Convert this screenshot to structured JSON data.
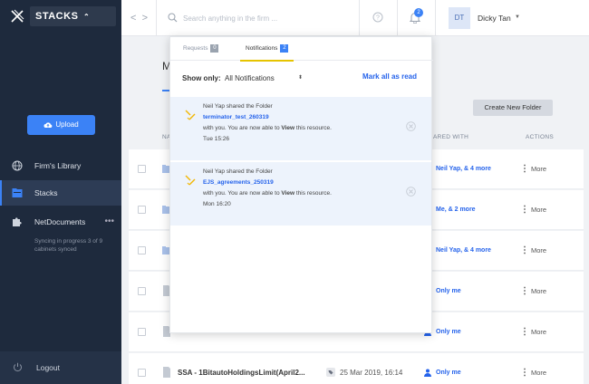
{
  "sidebar": {
    "app_name": "STACKS",
    "upload_label": "Upload",
    "items": [
      {
        "label": "Firm's Library"
      },
      {
        "label": "Stacks"
      },
      {
        "label": "NetDocuments",
        "extra": "•••"
      }
    ],
    "sync_note": "Syncing in progress 3 of 9 cabinets synced",
    "logout_label": "Logout"
  },
  "topbar": {
    "search_placeholder": "Search anything in the firm ...",
    "notification_count": "2",
    "avatar_initials": "DT",
    "user_name": "Dicky Tan"
  },
  "page": {
    "title_initial": "M",
    "create_folder_label": "Create New Folder",
    "columns": {
      "name": "NA",
      "shared_with": "ARED WITH",
      "actions": "ACTIONS"
    },
    "rows": [
      {
        "shared": "Neil Yap, & 4 more",
        "more": "More"
      },
      {
        "shared": "Me, & 2 more",
        "more": "More"
      },
      {
        "shared": "Neil Yap, & 4 more",
        "more": "More"
      },
      {
        "shared": "Only me",
        "more": "More"
      },
      {
        "shared": "Only me",
        "more": "More"
      },
      {
        "name": "SSA - 1BitautoHoldingsLimit(April2...",
        "date": "25 Mar 2019, 16:14",
        "shared": "Only me",
        "more": "More"
      }
    ]
  },
  "notifications_panel": {
    "tabs": [
      {
        "label": "Requests",
        "count": "0"
      },
      {
        "label": "Notifications",
        "count": "2"
      }
    ],
    "show_only_label": "Show only:",
    "filter_value": "All Notifications",
    "mark_all_label": "Mark all as read",
    "items": [
      {
        "line1": "Neil Yap shared the Folder",
        "folder": "terminator_test_260319",
        "line3_prefix": "with you. You are now able to ",
        "line3_bold": "View",
        "line3_suffix": " this resource.",
        "time": "Tue 15:26"
      },
      {
        "line1": "Neil Yap shared the Folder",
        "folder": "EJS_agreements_250319",
        "line3_prefix": "with you. You are now able to ",
        "line3_bold": "View",
        "line3_suffix": " this resource.",
        "time": "Mon 16:20"
      }
    ]
  },
  "colors": {
    "sidebar_bg": "#1e2a3d",
    "accent": "#3b82f6",
    "link": "#2563eb",
    "notification_bg": "#edf3fc",
    "tab_underline": "#e6c400"
  }
}
